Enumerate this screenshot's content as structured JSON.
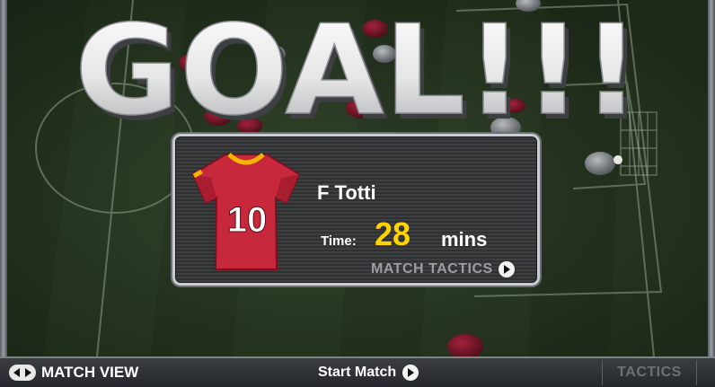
{
  "headline": "GOAL!!!",
  "scorer": {
    "shirt_number": "10",
    "player_name": "F Totti",
    "time_label": "Time:",
    "time_value": "28",
    "time_unit": "mins",
    "match_tactics_label": "MATCH TACTICS"
  },
  "bottom_bar": {
    "match_view_label": "MATCH VIEW",
    "start_match_label": "Start Match",
    "tactics_label": "TACTICS"
  },
  "icons": {
    "match_view": "left-right-arrows-icon",
    "start_match": "play-icon",
    "match_tactics": "play-icon"
  },
  "colors": {
    "pitch": "#2b3a24",
    "headline": "#f2f2f2",
    "time_value": "#ffd400",
    "shirt": "#c8283c",
    "shirt_trim": "#f4b400"
  }
}
